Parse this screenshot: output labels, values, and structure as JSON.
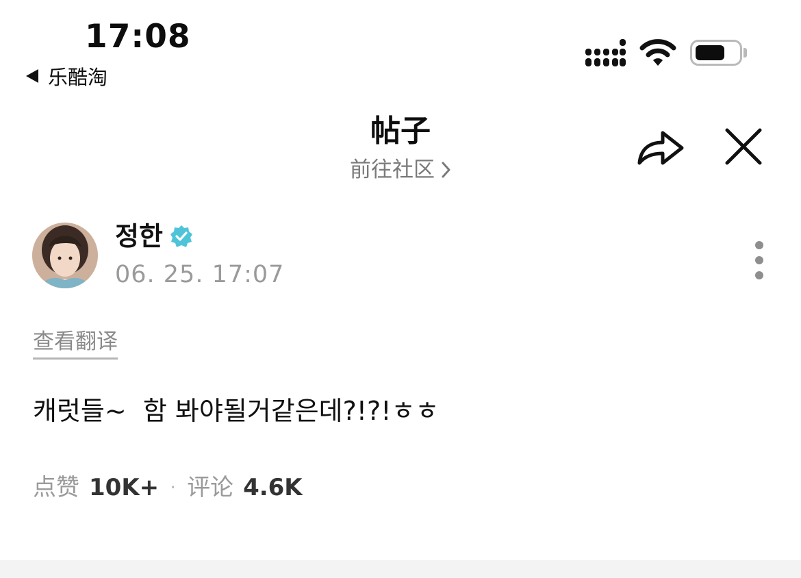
{
  "status_bar": {
    "time": "17:08",
    "back_app": "乐酷淘"
  },
  "header": {
    "title": "帖子",
    "community_link": "前往社区"
  },
  "post": {
    "author": "정한",
    "timestamp": "06. 25. 17:07",
    "translate_label": "查看翻译",
    "body": "캐럿들~  함 봐야될거같은데?!?!ㅎㅎ",
    "stats": {
      "likes_label": "点赞",
      "likes_value": "10K+",
      "separator": "·",
      "comments_label": "评论",
      "comments_value": "4.6K"
    }
  },
  "icons": {
    "back": "back-triangle-icon",
    "signal": "cellular-signal-icon",
    "wifi": "wifi-icon",
    "battery": "battery-icon",
    "share": "share-arrow-icon",
    "close": "close-icon",
    "verified": "verified-badge-icon",
    "more": "more-vertical-icon",
    "chevron": "chevron-right-icon"
  },
  "colors": {
    "verified": "#4fc4d9",
    "muted_text": "#9a9a9a",
    "text": "#111111"
  }
}
